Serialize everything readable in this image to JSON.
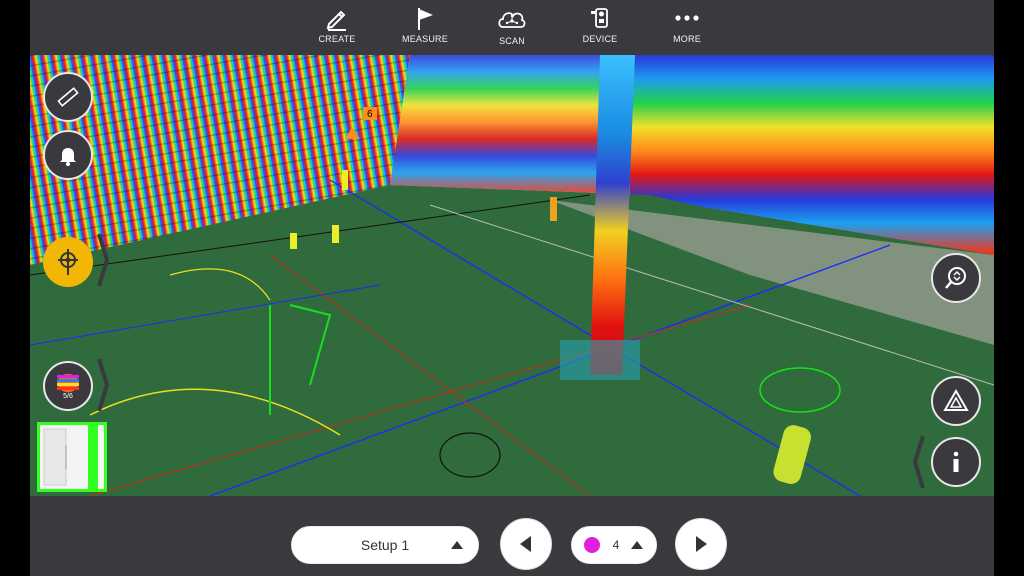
{
  "toolbar": {
    "items": [
      {
        "label": "CREATE",
        "icon": "pencil-icon"
      },
      {
        "label": "MEASURE",
        "icon": "flag-icon"
      },
      {
        "label": "SCAN",
        "icon": "scan-cloud-icon"
      },
      {
        "label": "DEVICE",
        "icon": "device-icon"
      },
      {
        "label": "MORE",
        "icon": "more-dots-icon"
      }
    ]
  },
  "left_panel": {
    "ruler_icon": "ruler-icon",
    "bell_icon": "bell-icon",
    "station_icon": "station-target-icon",
    "color_mode_icon": "rainbow-color-icon",
    "color_mode_count": "5/6",
    "thumbnail_icon": "thumbnail-icon"
  },
  "right_panel": {
    "zoom_icon": "zoom-icon",
    "triangle_icon": "triangle-layers-icon",
    "info_icon": "info-icon"
  },
  "bottom": {
    "setup_label": "Setup 1",
    "station_count": "4",
    "marker_color": "#e01ee0"
  },
  "viewport": {
    "marker_label": "6"
  },
  "colors": {
    "toolbar_bg": "#3a3a3e",
    "accent_yellow": "#f2b705",
    "floor_green": "#2f6a3a"
  }
}
